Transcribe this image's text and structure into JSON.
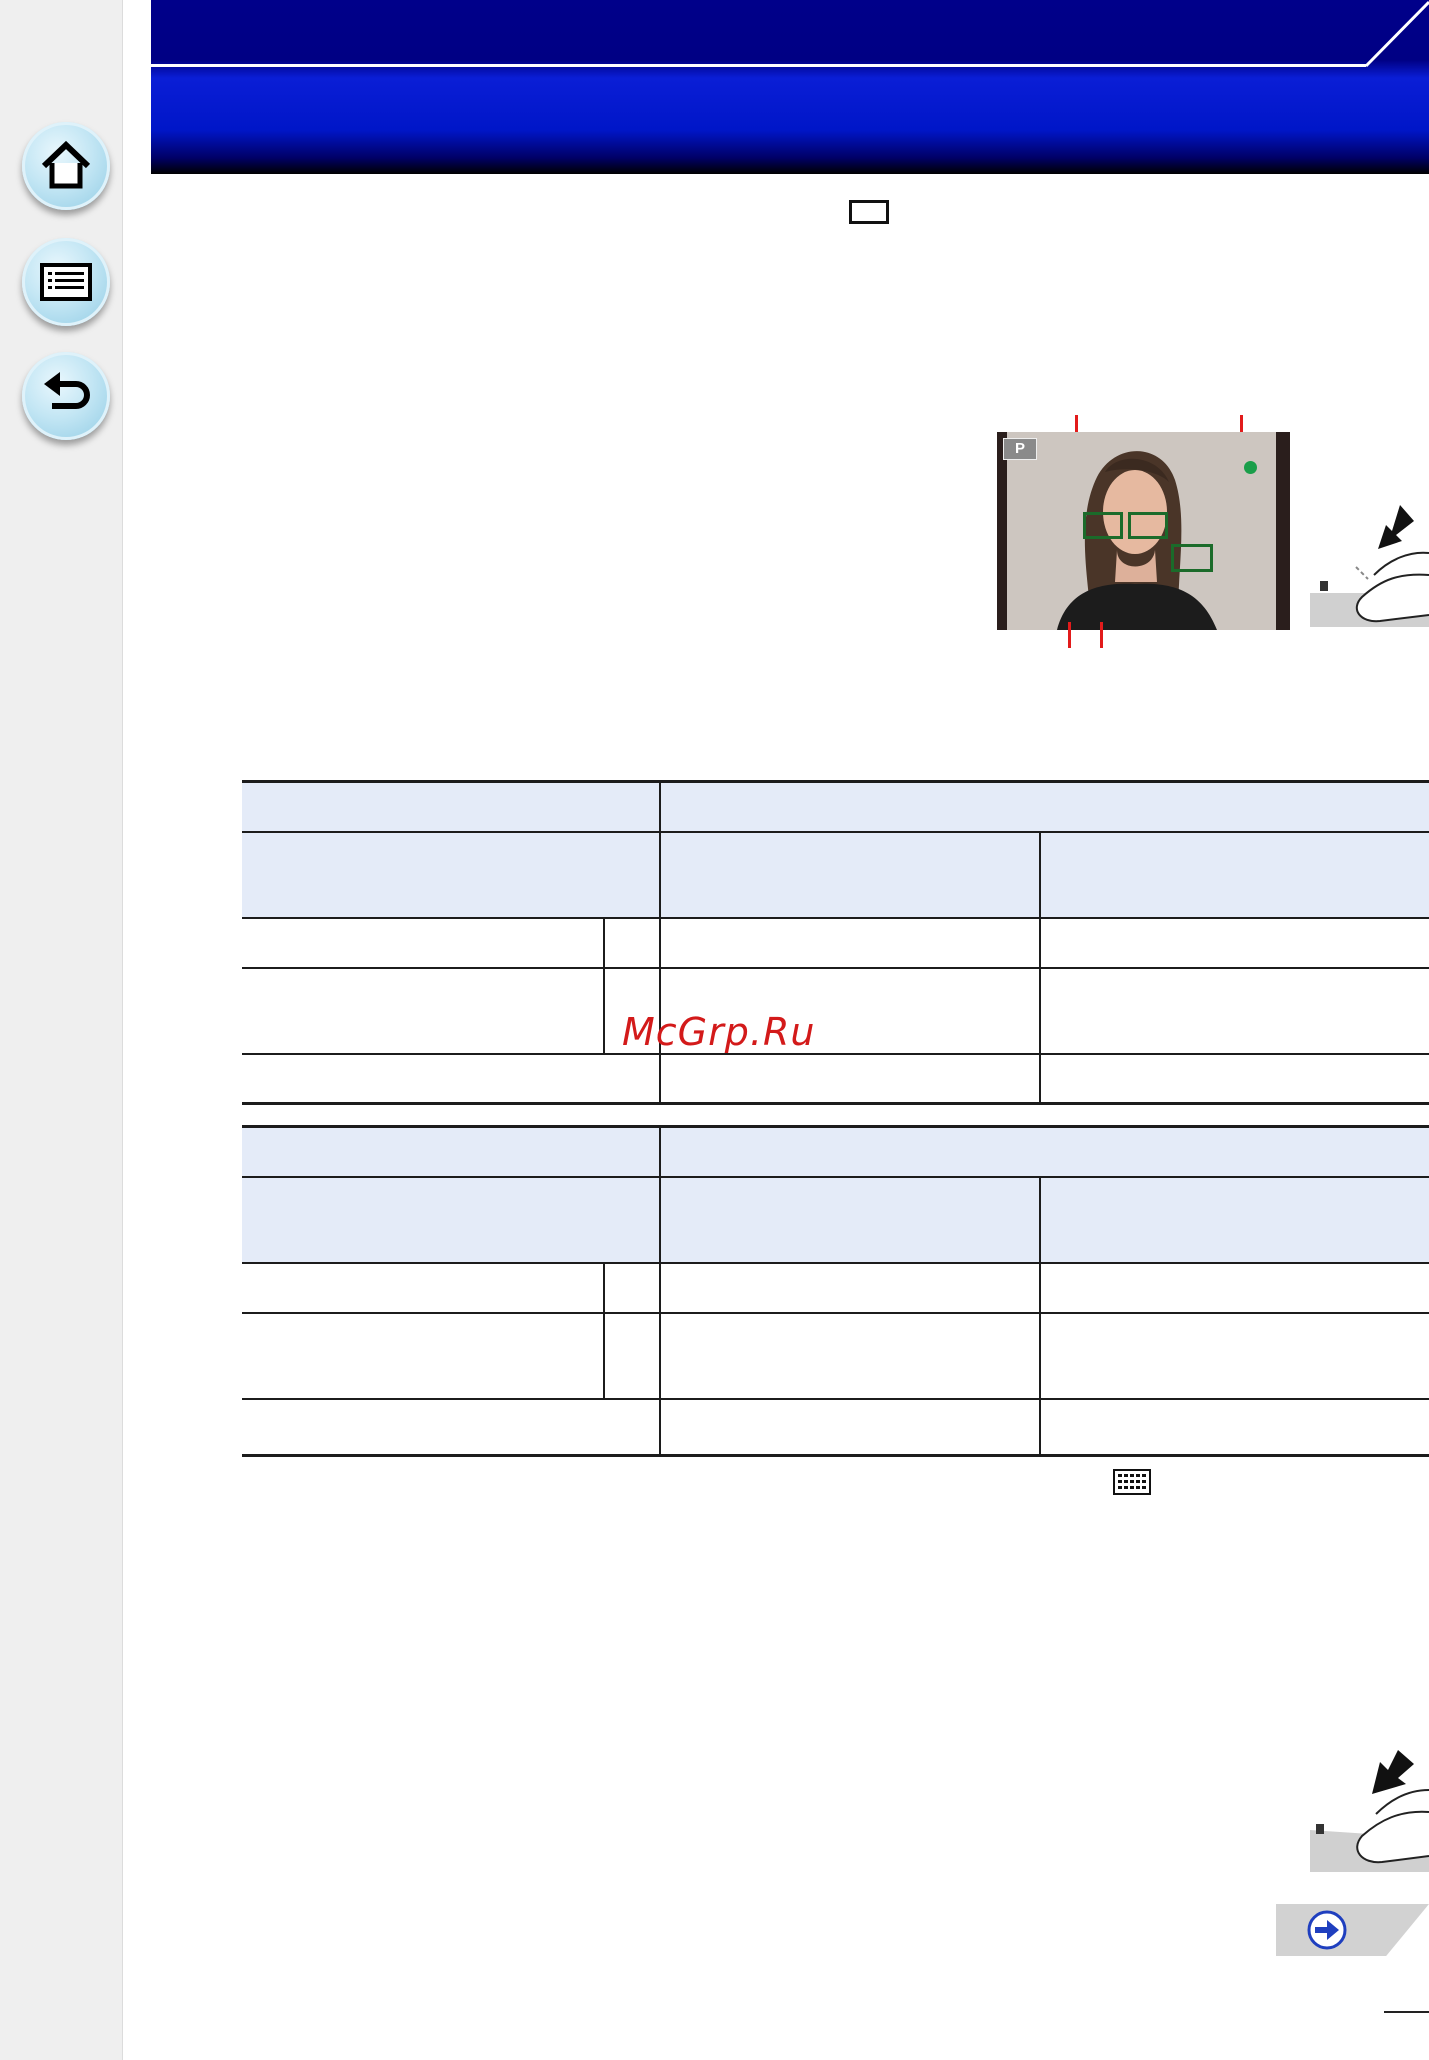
{
  "sidebar": {
    "buttons": [
      {
        "name": "home",
        "icon": "home-icon"
      },
      {
        "name": "contents",
        "icon": "list-icon"
      },
      {
        "name": "back",
        "icon": "return-arrow-icon"
      }
    ]
  },
  "header": {
    "title": "",
    "background": "#00008a",
    "accent": "#0a1ed6"
  },
  "icons": {
    "mode": "rectangle-mode-icon",
    "photo_mode_badge": "P",
    "focus_indicator_color": "#1a9e4a",
    "af_frame_color": "#1b6b2a",
    "callout_color": "#e21b1b",
    "af_area_icon": "multi-area-af-icon",
    "next_page": "right-arrow-icon"
  },
  "tables": [
    {
      "header_color": "#e4ebf8",
      "rows": 6
    },
    {
      "header_color": "#e4ebf8",
      "rows": 6
    }
  ],
  "watermark": "McGrp.Ru"
}
